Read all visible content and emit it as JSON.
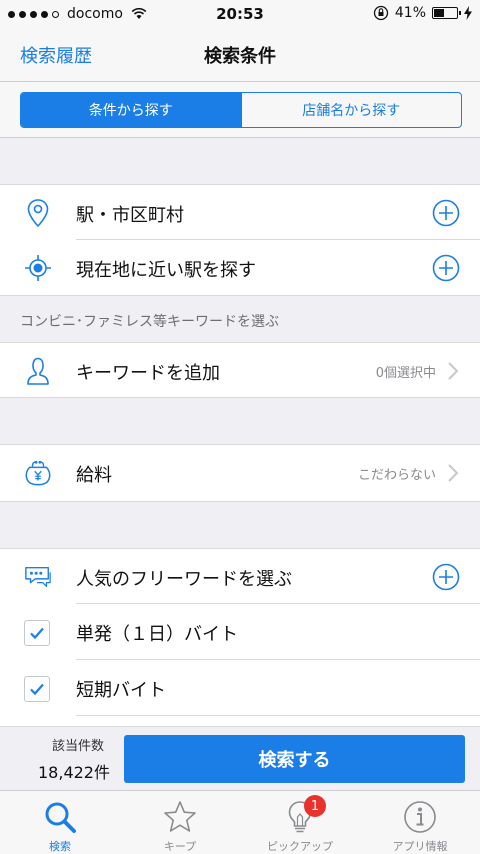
{
  "status": {
    "carrier": "docomo",
    "time": "20:53",
    "battery": "41%"
  },
  "nav": {
    "back": "検索履歴",
    "title": "検索条件"
  },
  "segments": [
    {
      "label": "条件から探す",
      "active": true
    },
    {
      "label": "店舗名から探す",
      "active": false
    }
  ],
  "rows": {
    "station": "駅・市区町村",
    "nearby": "現在地に近い駅を探す",
    "keyword_header": "コンビニ･ファミレス等キーワードを選ぶ",
    "keyword": "キーワードを追加",
    "keyword_value": "0個選択中",
    "salary": "給料",
    "salary_value": "こだわらない",
    "popular": "人気のフリーワードを選ぶ",
    "check1": "単発（１日）バイト",
    "check2": "短期バイト"
  },
  "bottom": {
    "count_label": "該当件数",
    "count_value": "18,422件",
    "search_button": "検索する"
  },
  "tabs": [
    {
      "label": "検索",
      "icon": "search-icon",
      "active": true
    },
    {
      "label": "キープ",
      "icon": "star-icon",
      "active": false
    },
    {
      "label": "ピックアップ",
      "icon": "lightbulb-icon",
      "active": false,
      "badge": "1"
    },
    {
      "label": "アプリ情報",
      "icon": "info-icon",
      "active": false
    }
  ],
  "colors": {
    "accent": "#1a7ee6",
    "badge": "#e8322b"
  }
}
